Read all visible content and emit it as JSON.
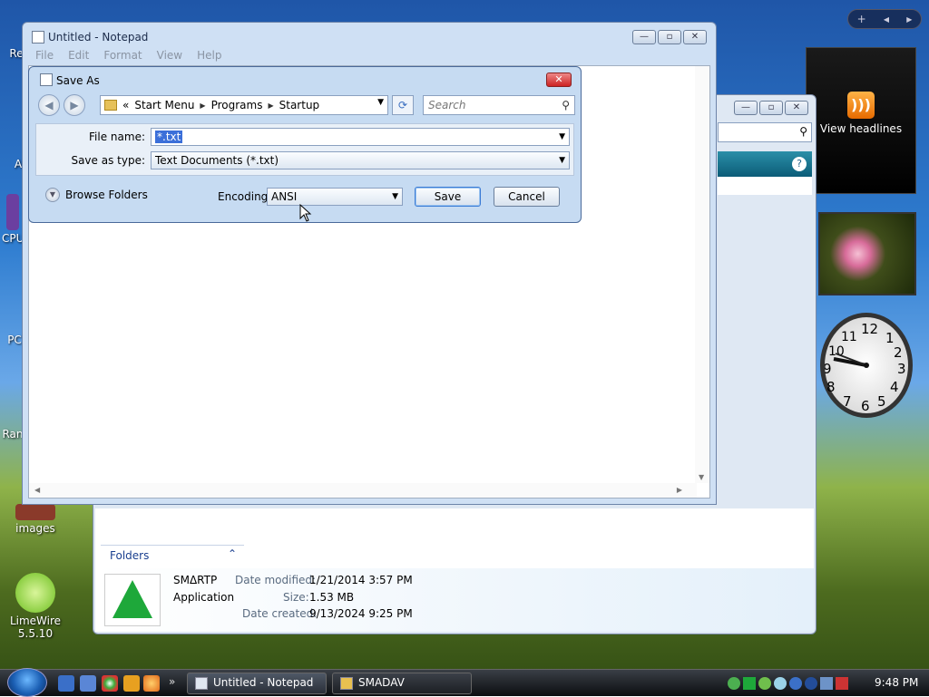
{
  "desktop": {
    "icons": [
      {
        "label": "Re"
      },
      {
        "label": "A"
      },
      {
        "label": "CPU"
      },
      {
        "label": "PC"
      },
      {
        "label": "Ran"
      },
      {
        "label": "images"
      },
      {
        "label": "LimeWire 5.5.10"
      }
    ]
  },
  "sidebar": {
    "controls": {
      "add": "+",
      "prev": "◀",
      "next": "▶"
    },
    "feed": {
      "label": "View headlines"
    },
    "clock": {
      "numbers": [
        "12",
        "1",
        "2",
        "3",
        "4",
        "5",
        "6",
        "7",
        "8",
        "9",
        "10",
        "11"
      ]
    }
  },
  "explorer": {
    "folders_label": "Folders",
    "details": {
      "name": "SMΔRTP",
      "type": "Application",
      "modified_label": "Date modified:",
      "modified_value": "1/21/2014 3:57 PM",
      "size_label": "Size:",
      "size_value": "1.53 MB",
      "created_label": "Date created:",
      "created_value": "9/13/2024 9:25 PM"
    }
  },
  "notepad": {
    "title": "Untitled - Notepad",
    "menu": [
      "File",
      "Edit",
      "Format",
      "View",
      "Help"
    ]
  },
  "save_dialog": {
    "title": "Save As",
    "breadcrumb": {
      "prefix": "«",
      "segments": [
        "Start Menu",
        "Programs",
        "Startup"
      ]
    },
    "search_placeholder": "Search",
    "file_name_label": "File name:",
    "file_name_value": "*.txt",
    "save_type_label": "Save as type:",
    "save_type_value": "Text Documents (*.txt)",
    "browse_label": "Browse Folders",
    "encoding_label": "Encoding:",
    "encoding_value": "ANSI",
    "save_button": "Save",
    "cancel_button": "Cancel"
  },
  "taskbar": {
    "tasks": [
      {
        "label": "Untitled - Notepad"
      },
      {
        "label": "SMADAV"
      }
    ],
    "overflow": "»",
    "time": "9:48 PM"
  }
}
